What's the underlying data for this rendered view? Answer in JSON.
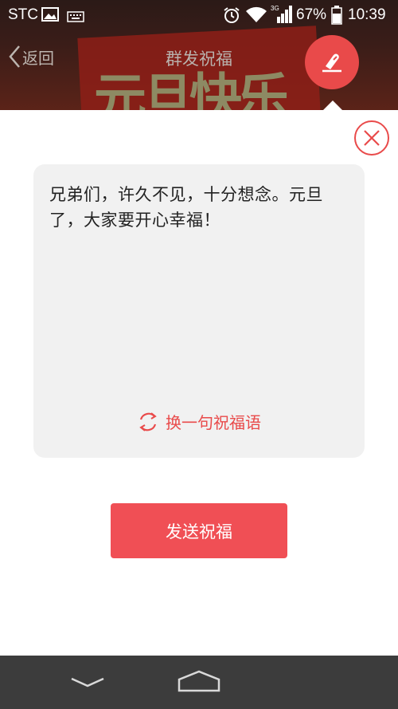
{
  "status_bar": {
    "carrier": "STC",
    "battery_percent": "67%",
    "time": "10:39",
    "icons": [
      "image-icon",
      "keyboard-icon",
      "alarm-icon",
      "wifi-icon",
      "signal-3g-icon",
      "battery-icon"
    ]
  },
  "header": {
    "back_label": "返回",
    "title": "群发祝福",
    "banner_art_text": "元旦快乐",
    "edit_icon": "pen-icon"
  },
  "message": {
    "text": "兄弟们，许久不见，十分想念。元旦了，大家要开心幸福！",
    "refresh_label": "换一句祝福语"
  },
  "actions": {
    "send_label": "发送祝福"
  },
  "colors": {
    "accent": "#e94a4a",
    "send_button": "#f04f55",
    "card_bg": "#f1f1f1",
    "navbar_bg": "#3c3c3c"
  }
}
